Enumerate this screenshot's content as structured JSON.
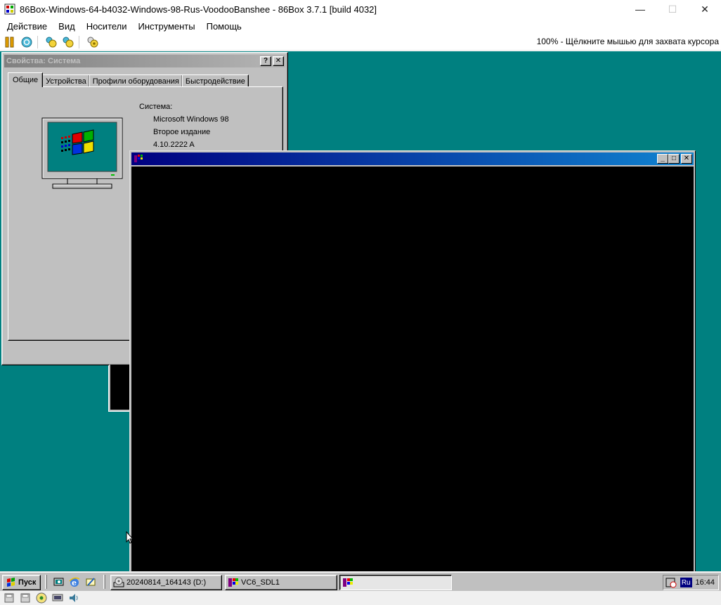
{
  "host": {
    "title": "86Box-Windows-64-b4032-Windows-98-Rus-VoodooBanshee - 86Box 3.7.1 [build 4032]",
    "controls": {
      "minimize": "—",
      "maximize": "☐",
      "close": "✕"
    },
    "menu": [
      "Действие",
      "Вид",
      "Носители",
      "Инструменты",
      "Помощь"
    ],
    "toolbar_icons": [
      "pause-icon",
      "reset-icon",
      "ctrl-alt-del-icon",
      "ctrl-alt-esc-icon",
      "settings-icon"
    ],
    "status_text": "100% - Щёлкните мышью для захвата курсора",
    "statusbar_icons": [
      "floppy-a-icon",
      "floppy-b-icon",
      "cdrom-icon",
      "network-icon",
      "sound-icon"
    ]
  },
  "system_properties": {
    "title": "Свойства: Система",
    "help_btn": "?",
    "close_btn": "✕",
    "tabs": [
      "Общие",
      "Устройства",
      "Профили оборудования",
      "Быстродействие"
    ],
    "active_tab": 0,
    "system_label": "Система:",
    "os_name": "Microsoft Windows 98",
    "edition": "Второе издание",
    "version": "4.10.2222 A"
  },
  "black_window": {
    "title": "",
    "min": "_",
    "max": "□",
    "close": "✕"
  },
  "taskbar": {
    "start_label": "Пуск",
    "tasks": [
      {
        "label": "20240814_164143 (D:)",
        "pressed": false
      },
      {
        "label": "VC6_SDL1",
        "pressed": false
      },
      {
        "label": "",
        "pressed": true
      }
    ],
    "language": "Ru",
    "clock": "16:44"
  },
  "colors": {
    "desktop": "#008080",
    "win98_face": "#c0c0c0",
    "active_caption": "#000080",
    "inactive_caption": "#808080"
  }
}
